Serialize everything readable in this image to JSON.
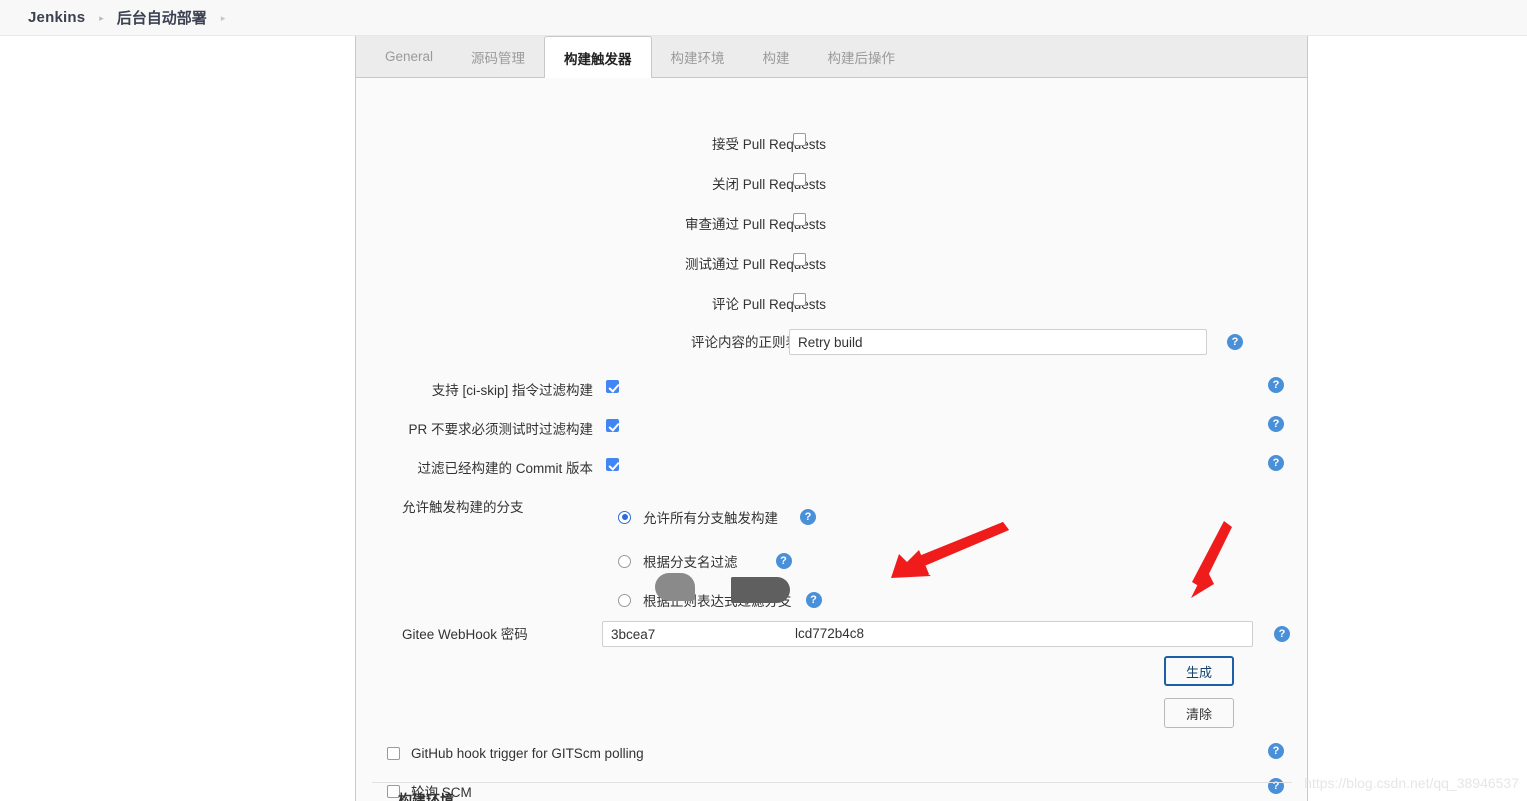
{
  "breadcrumb": {
    "root": "Jenkins",
    "separator": "▸",
    "job": "后台自动部署",
    "separator2": "▸"
  },
  "tabs": [
    {
      "label": "General",
      "active": false
    },
    {
      "label": "源码管理",
      "active": false
    },
    {
      "label": "构建触发器",
      "active": true
    },
    {
      "label": "构建环境",
      "active": false
    },
    {
      "label": "构建",
      "active": false
    },
    {
      "label": "构建后操作",
      "active": false
    }
  ],
  "pull_request_options": [
    {
      "label": "接受 Pull Requests",
      "checked": false
    },
    {
      "label": "关闭 Pull Requests",
      "checked": false
    },
    {
      "label": "审查通过 Pull Requests",
      "checked": false
    },
    {
      "label": "测试通过 Pull Requests",
      "checked": false
    },
    {
      "label": "评论 Pull Requests",
      "checked": false
    }
  ],
  "comment_regex": {
    "label": "评论内容的正则表达式",
    "value": "Retry build",
    "placeholder": ""
  },
  "filter_options": [
    {
      "label": "支持 [ci-skip] 指令过滤构建",
      "checked": true
    },
    {
      "label": "PR 不要求必须测试时过滤构建",
      "checked": true
    },
    {
      "label": "过滤已经构建的 Commit 版本",
      "checked": true
    }
  ],
  "branch_filter": {
    "label": "允许触发构建的分支",
    "options": [
      {
        "label": "允许所有分支触发构建",
        "selected": true
      },
      {
        "label": "根据分支名过滤",
        "selected": false
      },
      {
        "label": "根据正则表达式过滤分支",
        "selected": false
      }
    ]
  },
  "webhook": {
    "label": "Gitee WebHook 密码",
    "value_prefix": "3bcea7",
    "value_suffix": "lcd772b4c8",
    "generate_button": "生成",
    "clear_button": "清除"
  },
  "trigger_options": [
    {
      "label": "GitHub hook trigger for GITScm polling",
      "checked": false
    },
    {
      "label": "轮询 SCM",
      "checked": false
    }
  ],
  "cut_off_heading": "构建环境",
  "help_icon": "?",
  "watermark": "https://blog.csdn.net/qq_38946537",
  "colors": {
    "accent_blue": "#4285f4",
    "help_blue": "#4a90d9",
    "radio_blue": "#2b6ce0",
    "primary_border": "#1c5fa8",
    "annotation_red": "#f01c1c",
    "panel_bg": "#fafafa",
    "tabbar_bg": "#ececec"
  }
}
